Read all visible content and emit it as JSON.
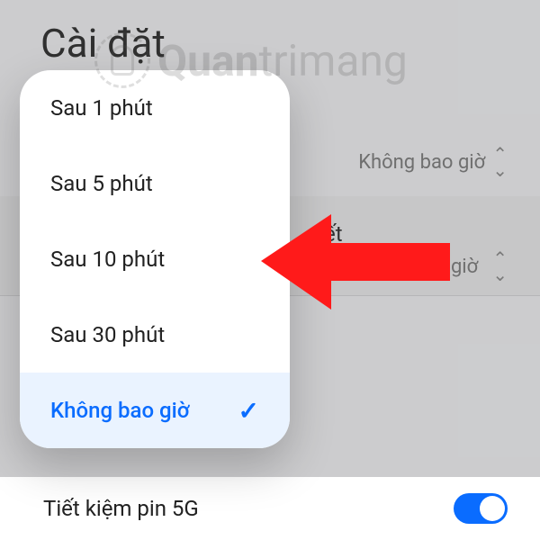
{
  "page": {
    "title": "Cài đặt"
  },
  "background": {
    "row1_value": "Không bao giờ",
    "row2_label_suffix": "ết",
    "row2_value": "Không bao giờ",
    "bottom_label": "Tiết kiệm pin 5G"
  },
  "popup": {
    "items": [
      {
        "label": "Sau 1 phút",
        "selected": false
      },
      {
        "label": "Sau 5 phút",
        "selected": false
      },
      {
        "label": "Sau 10 phút",
        "selected": false
      },
      {
        "label": "Sau 30 phút",
        "selected": false
      },
      {
        "label": "Không bao giờ",
        "selected": true
      }
    ]
  },
  "watermark": {
    "brand_bold": "Quan",
    "brand_light": "trimang"
  }
}
